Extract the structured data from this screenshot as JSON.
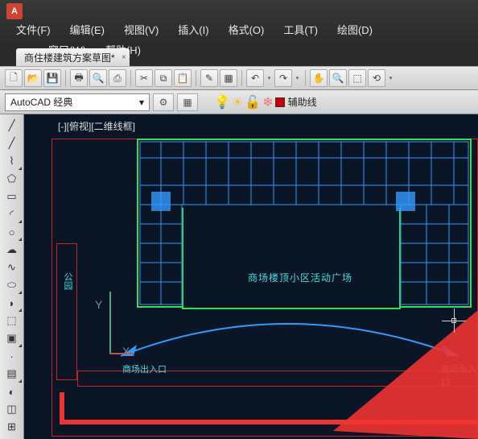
{
  "app_icon": "A",
  "menus": {
    "file": "文件(F)",
    "edit": "编辑(E)",
    "view": "视图(V)",
    "insert": "插入(I)",
    "format": "格式(O)",
    "tools": "工具(T)",
    "draw": "绘图(D)",
    "window": "窗口(W)",
    "help": "帮助(H)"
  },
  "tab": {
    "title": "商住楼建筑方案草图*",
    "close": "×"
  },
  "workspace": {
    "value": "AutoCAD 经典",
    "arrow": "▾"
  },
  "layer": {
    "name": "辅助线"
  },
  "canvas": {
    "viewport_label": "[-][俯视][二维线框]",
    "axis_y": "Y",
    "axis_x": "X",
    "plaza_label": "商场楼顶小区活动广场",
    "park_label": "公园",
    "entrance_l": "商场出入口",
    "entrance_r": "商场出入口"
  }
}
